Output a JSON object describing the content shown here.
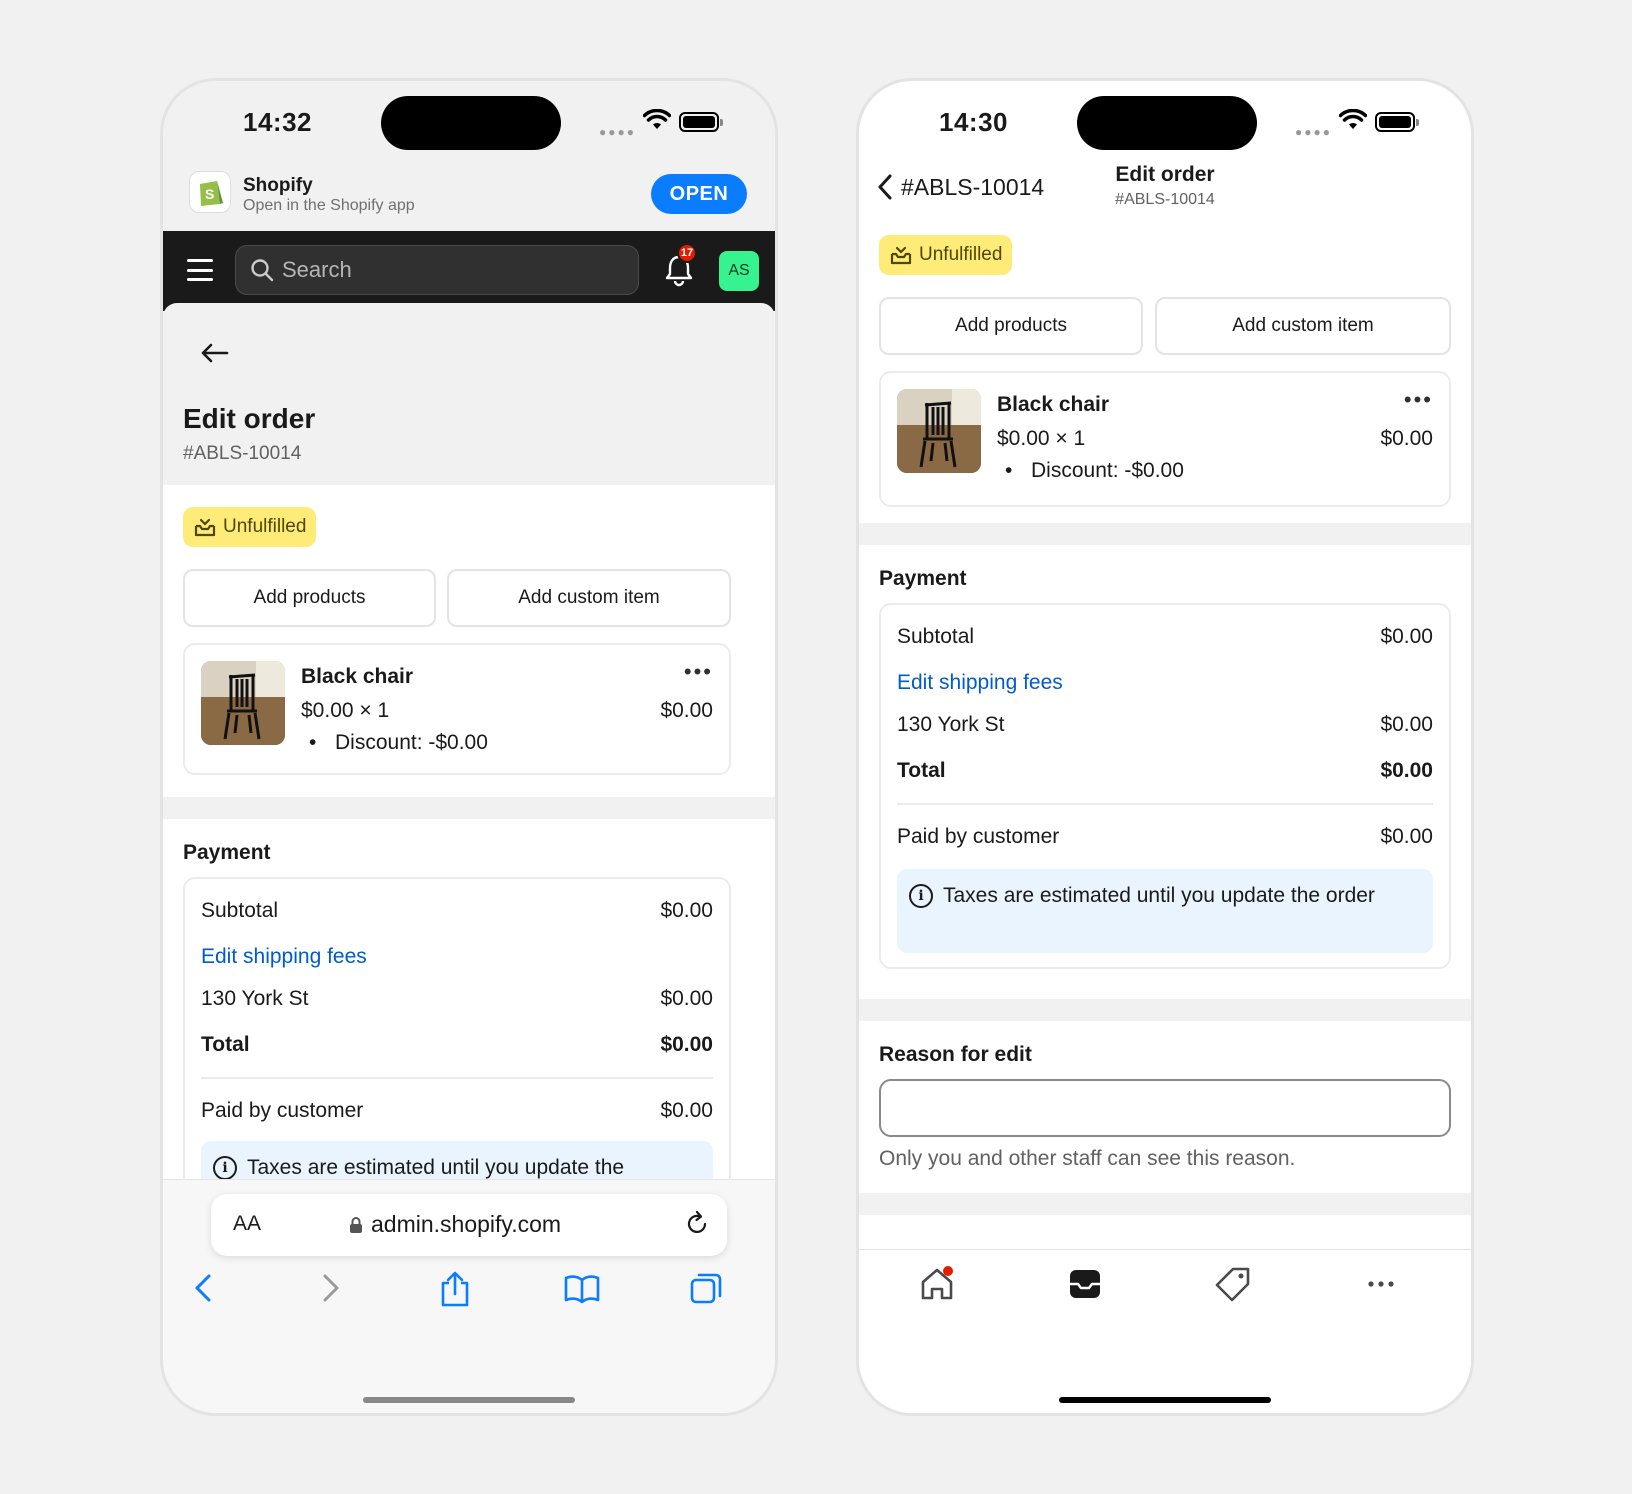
{
  "left": {
    "status": {
      "time": "14:32"
    },
    "banner": {
      "title": "Shopify",
      "subtitle": "Open in the Shopify app",
      "open_label": "OPEN"
    },
    "topbar": {
      "search_placeholder": "Search",
      "notification_count": "17",
      "avatar_initials": "AS"
    },
    "page": {
      "title": "Edit order",
      "order_number": "#ABLS-10014"
    },
    "status_badge": "Unfulfilled",
    "buttons": {
      "add_products": "Add products",
      "add_custom_item": "Add custom item"
    },
    "item": {
      "name": "Black chair",
      "price_qty": "$0.00 × 1",
      "discount": "Discount: -$0.00",
      "total": "$0.00"
    },
    "payment": {
      "title": "Payment",
      "subtotal_label": "Subtotal",
      "subtotal_value": "$0.00",
      "edit_shipping": "Edit shipping fees",
      "shipping_label": "130 York St",
      "shipping_value": "$0.00",
      "total_label": "Total",
      "total_value": "$0.00",
      "paid_label": "Paid by customer",
      "paid_value": "$0.00",
      "tax_note": "Taxes are estimated until you update the"
    },
    "browser": {
      "aa": "AA",
      "url": "admin.shopify.com"
    }
  },
  "right": {
    "status": {
      "time": "14:30"
    },
    "header": {
      "back_label": "#ABLS-10014",
      "title": "Edit order",
      "subtitle": "#ABLS-10014"
    },
    "status_badge": "Unfulfilled",
    "buttons": {
      "add_products": "Add products",
      "add_custom_item": "Add custom item"
    },
    "item": {
      "name": "Black chair",
      "price_qty": "$0.00 × 1",
      "discount": "Discount: -$0.00",
      "total": "$0.00"
    },
    "payment": {
      "title": "Payment",
      "subtotal_label": "Subtotal",
      "subtotal_value": "$0.00",
      "edit_shipping": "Edit shipping fees",
      "shipping_label": "130 York St",
      "shipping_value": "$0.00",
      "total_label": "Total",
      "total_value": "$0.00",
      "paid_label": "Paid by customer",
      "paid_value": "$0.00",
      "tax_note": "Taxes are estimated until you update the order"
    },
    "reason": {
      "title": "Reason for edit",
      "value": "",
      "helper": "Only you and other staff can see this reason."
    },
    "tabs": [
      "home-icon",
      "orders-icon",
      "products-icon",
      "more-icon"
    ]
  },
  "colors": {
    "accent_link": "#005bd3",
    "badge_bg": "#ffeb78",
    "open_button": "#0a7cff",
    "avatar": "#36f28f",
    "info_bg": "#eaf4ff"
  }
}
